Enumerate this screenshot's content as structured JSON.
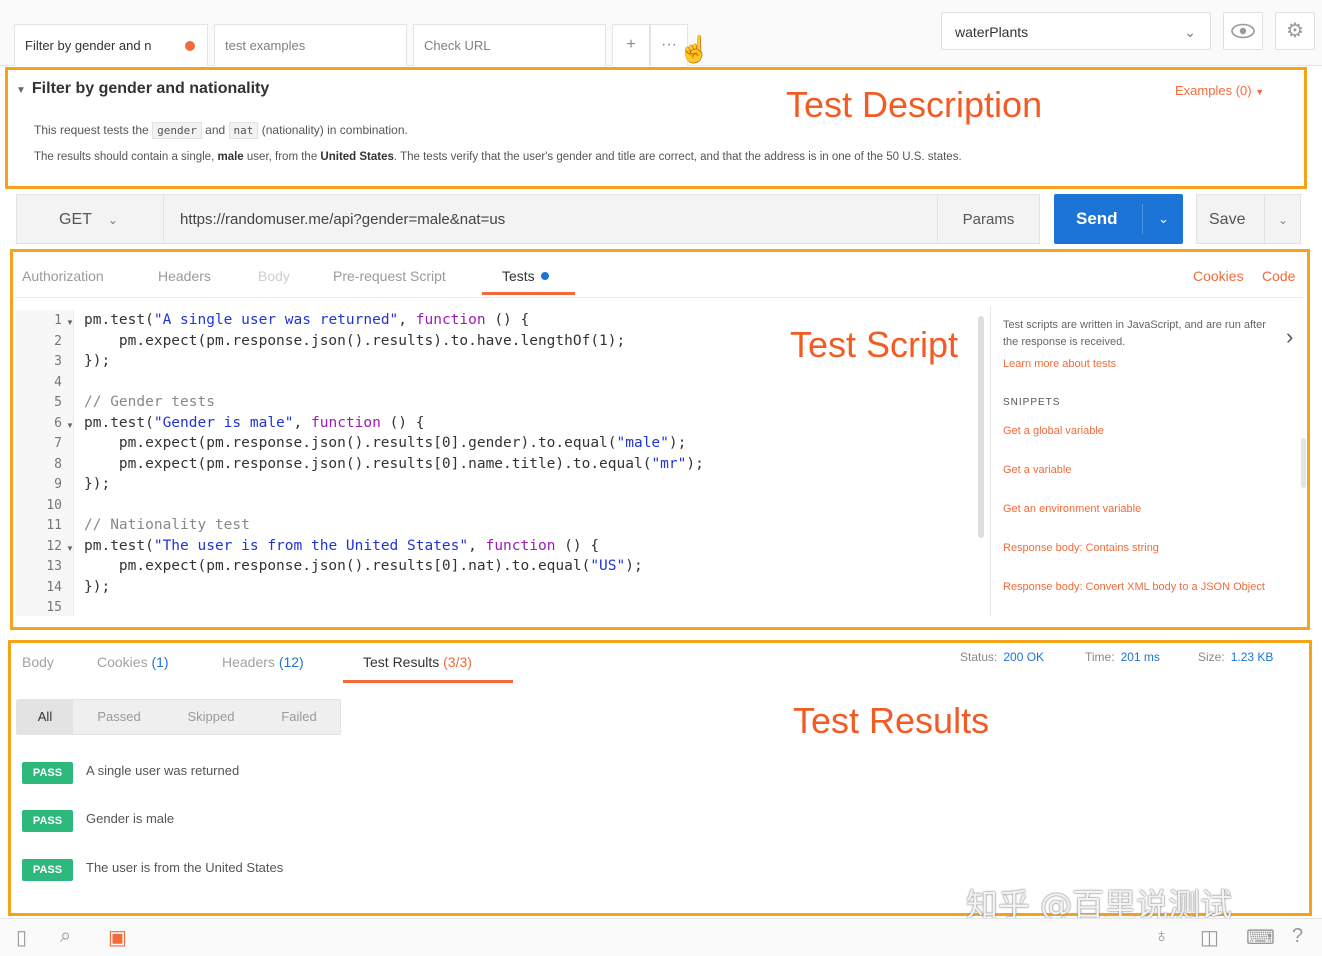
{
  "tabs": [
    {
      "label": "Filter by gender and n",
      "unsaved": true
    },
    {
      "label": "test examples"
    },
    {
      "label": "Check URL"
    }
  ],
  "tab_actions": {
    "add_icon": "+",
    "more_icon": "···"
  },
  "environment": {
    "selected": "waterPlants"
  },
  "annotations": {
    "description": "Test Description",
    "script": "Test Script",
    "results": "Test Results"
  },
  "description": {
    "title": "Filter by gender and nationality",
    "examples": "Examples (0)",
    "line1_prefix": "This request tests the",
    "line1_code1": "gender",
    "line1_and": "and",
    "line1_code2": "nat",
    "line1_suffix": "(nationality) in combination.",
    "line2_a": "The results should contain a single,",
    "line2_b": "male",
    "line2_c": "user, from the",
    "line2_d": "United States",
    "line2_e": ". The tests verify that the user's gender and title are correct, and that the address is in one of the 50 U.S. states."
  },
  "request": {
    "method": "GET",
    "url": "https://randomuser.me/api?gender=male&nat=us",
    "params_label": "Params",
    "send_label": "Send",
    "save_label": "Save"
  },
  "request_tabs": [
    "Authorization",
    "Headers",
    "Body",
    "Pre-request Script",
    "Tests"
  ],
  "request_links": {
    "cookies": "Cookies",
    "code": "Code"
  },
  "code": {
    "line_numbers": [
      "1",
      "2",
      "3",
      "4",
      "5",
      "6",
      "7",
      "8",
      "9",
      "10",
      "11",
      "12",
      "13",
      "14",
      "15"
    ],
    "l1a": "pm.test(",
    "l1b": "\"A single user was returned\"",
    "l1c": ", ",
    "l1d": "function",
    "l1e": " () {",
    "l2": "    pm.expect(pm.response.json().results).to.have.lengthOf(1);",
    "l3": "});",
    "l5": "// Gender tests",
    "l6a": "pm.test(",
    "l6b": "\"Gender is male\"",
    "l6c": ", ",
    "l6d": "function",
    "l6e": " () {",
    "l7a": "    pm.expect(pm.response.json().results[0].gender).to.equal(",
    "l7b": "\"male\"",
    "l7c": ");",
    "l8a": "    pm.expect(pm.response.json().results[0].name.title).to.equal(",
    "l8b": "\"mr\"",
    "l8c": ");",
    "l9": "});",
    "l11": "// Nationality test",
    "l12a": "pm.test(",
    "l12b": "\"The user is from the United States\"",
    "l12c": ", ",
    "l12d": "function",
    "l12e": " () {",
    "l13a": "    pm.expect(pm.response.json().results[0].nat).to.equal(",
    "l13b": "\"US\"",
    "l13c": ");",
    "l14": "});"
  },
  "snippets": {
    "intro": "Test scripts are written in JavaScript, and are run after the response is received.",
    "learn_more": "Learn more about tests",
    "heading": "SNIPPETS",
    "items": [
      "Get a global variable",
      "Get a variable",
      "Get an environment variable",
      "Response body: Contains string",
      "Response body: Convert XML body to a JSON Object"
    ]
  },
  "response": {
    "tabs": [
      {
        "label": "Body",
        "count": ""
      },
      {
        "label": "Cookies",
        "count": "(1)"
      },
      {
        "label": "Headers",
        "count": "(12)"
      },
      {
        "label": "Test Results",
        "count": "(3/3)"
      }
    ],
    "status_label": "Status:",
    "status_value": "200 OK",
    "time_label": "Time:",
    "time_value": "201 ms",
    "size_label": "Size:",
    "size_value": "1.23 KB",
    "filters": [
      "All",
      "Passed",
      "Skipped",
      "Failed"
    ],
    "results": [
      {
        "badge": "PASS",
        "text": "A single user was returned"
      },
      {
        "badge": "PASS",
        "text": "Gender is male"
      },
      {
        "badge": "PASS",
        "text": "The user is from the United States"
      }
    ]
  },
  "watermark": "知乎 @百里说测试",
  "colors": {
    "accent": "#f26b3a",
    "send": "#1b74d6",
    "pass": "#2db87d",
    "frame": "#f7a21b"
  }
}
